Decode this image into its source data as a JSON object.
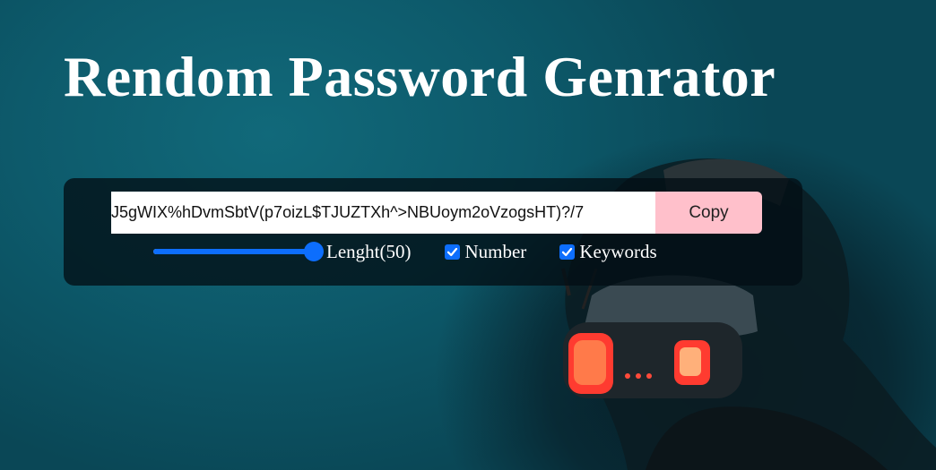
{
  "page": {
    "title": "Rendom Password Genrator"
  },
  "generator": {
    "password": "7/?J5gWIX%hDvmSbtV(p7oizL$TJUZTXh^>NBUoym2oVzogsHT)",
    "copy_label": "Copy",
    "length": {
      "label": "Lenght(50)",
      "value": 50,
      "min": 0,
      "max": 50
    },
    "options": [
      {
        "label": "Number",
        "checked": true
      },
      {
        "label": "Keywords",
        "checked": true
      }
    ]
  },
  "colors": {
    "accent": "#0d6efd",
    "copy_button": "#ffc0cb",
    "panel": "#020e14",
    "background": "#0b4b5a"
  }
}
